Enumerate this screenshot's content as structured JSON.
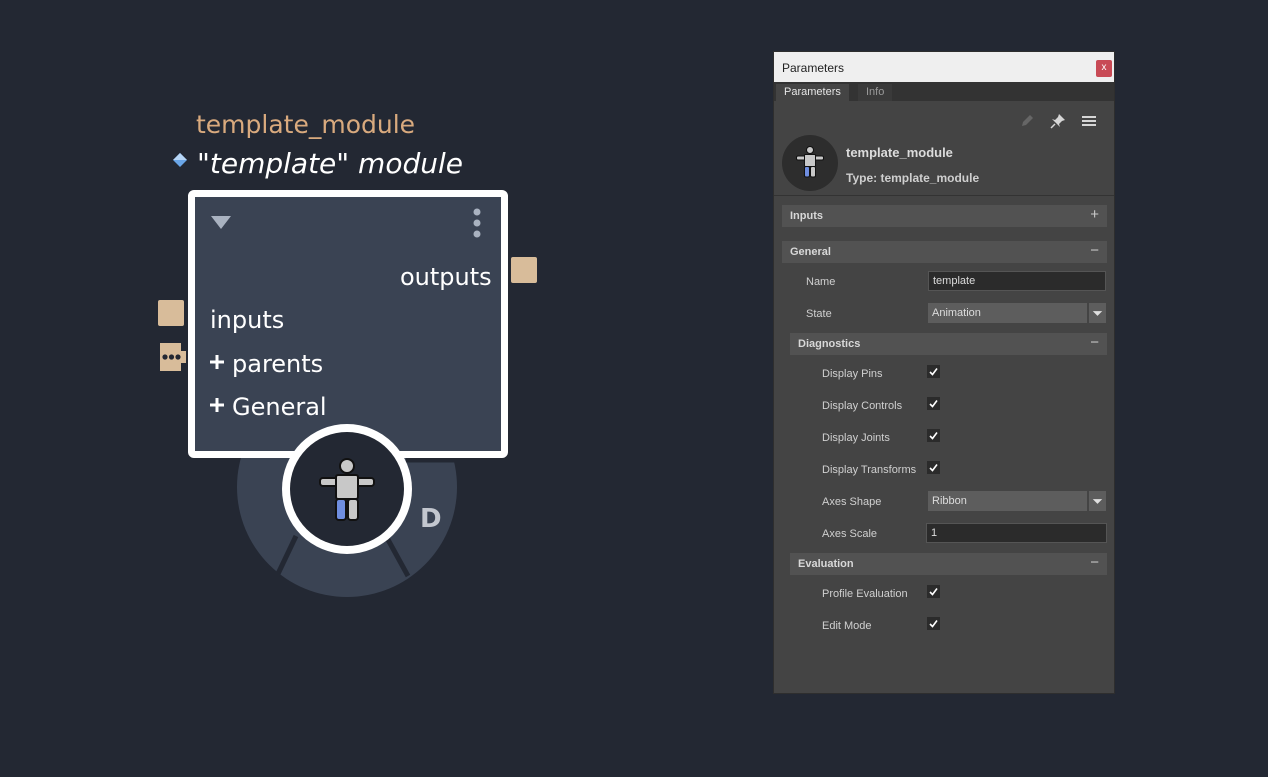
{
  "node": {
    "name": "template_module",
    "title": "\"template\" module",
    "outputs_label": "outputs",
    "inputs_label": "inputs",
    "parents_label": "parents",
    "general_label": "General",
    "badge": "D"
  },
  "panel": {
    "title": "Parameters",
    "close_label": "x",
    "tabs": [
      "Parameters",
      "Info"
    ],
    "module_name": "template_module",
    "module_type": "Type: template_module",
    "sections": {
      "inputs": "Inputs",
      "general": "General",
      "diagnostics": "Diagnostics",
      "evaluation": "Evaluation"
    },
    "fields": {
      "name_label": "Name",
      "name_value": "template",
      "state_label": "State",
      "state_value": "Animation",
      "display_pins": "Display Pins",
      "display_controls": "Display Controls",
      "display_joints": "Display Joints",
      "display_transforms": "Display Transforms",
      "axes_shape_label": "Axes Shape",
      "axes_shape_value": "Ribbon",
      "axes_scale_label": "Axes Scale",
      "axes_scale_value": "1",
      "profile_evaluation": "Profile Evaluation",
      "edit_mode": "Edit Mode"
    },
    "checked": {
      "display_pins": true,
      "display_controls": true,
      "display_joints": true,
      "display_transforms": true,
      "profile_evaluation": true,
      "edit_mode": true
    },
    "toggles": {
      "expand": "+",
      "collapse": "−"
    }
  },
  "colors": {
    "canvas": "#232833",
    "node_fill": "#3a4353",
    "port": "#d8bc9a",
    "name_text": "#d9aa7e",
    "panel": "#444444"
  }
}
